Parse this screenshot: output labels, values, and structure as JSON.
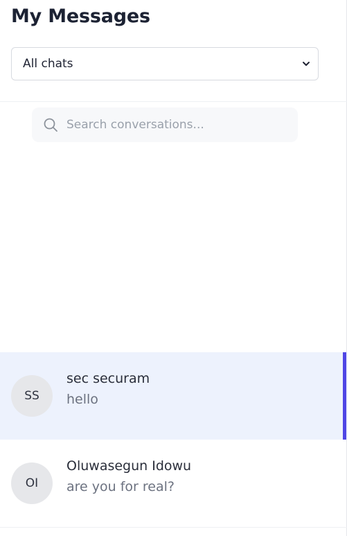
{
  "header": {
    "title": "My Messages"
  },
  "filter": {
    "selected": "All chats"
  },
  "search": {
    "placeholder": "Search conversations..."
  },
  "chats": [
    {
      "initials": "SS",
      "name": "sec securam",
      "preview": "hello",
      "active": true
    },
    {
      "initials": "OI",
      "name": "Oluwasegun Idowu",
      "preview": "are you for real?",
      "active": false
    }
  ],
  "colors": {
    "accent": "#4f46e5",
    "active_bg": "#edf2fd",
    "avatar_bg": "#e6e7ea"
  },
  "icons": {
    "search": "search-icon",
    "dropdown": "chevron-down-icon"
  }
}
